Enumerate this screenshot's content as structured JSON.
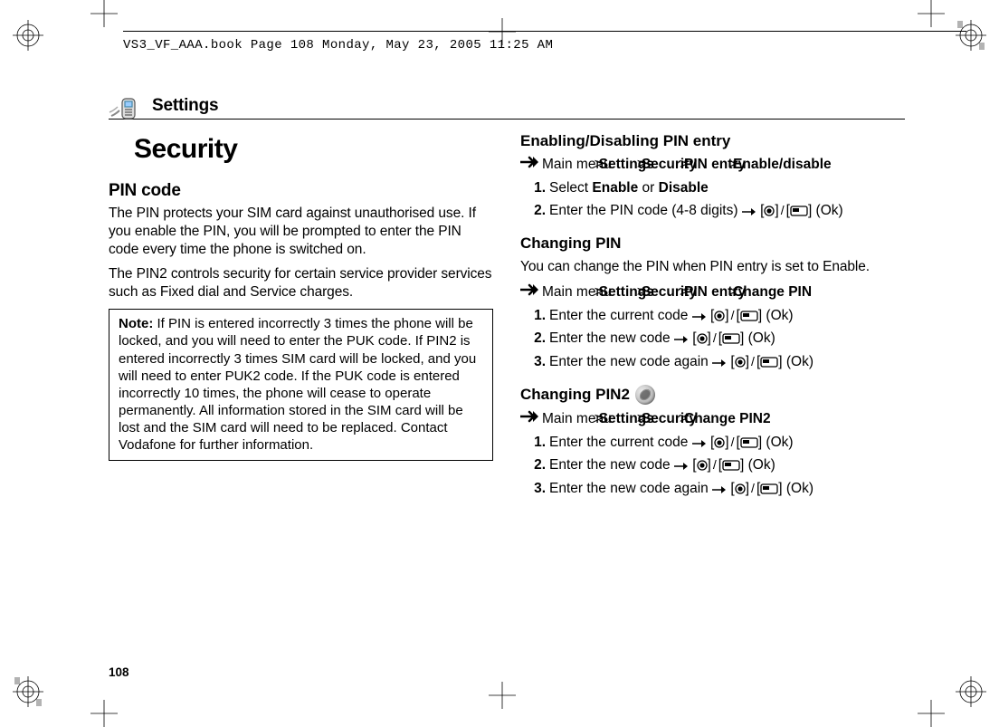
{
  "print_header": "VS3_VF_AAA.book  Page 108  Monday, May 23, 2005  11:25 AM",
  "section_heading": "Settings",
  "page_title": "Security",
  "page_number": "108",
  "left": {
    "h_pin_code": "PIN code",
    "p1": "The PIN protects your SIM card against unauthorised use. If you enable the PIN, you will be prompted to enter the PIN code every time the phone is switched on.",
    "p2": "The PIN2 controls security for certain service provider services such as Fixed dial and Service charges.",
    "note_label": "Note:",
    "note_body": "If PIN is entered incorrectly 3 times the phone will be locked, and you will need to enter the PUK code. If PIN2 is entered incorrectly 3 times SIM card will be locked, and you will need to enter PUK2 code. If the PUK code is entered incorrectly 10 times, the phone will cease to operate permanently. All information stored in the SIM card will be lost and the SIM card will need to be replaced. Contact Vodafone for further information."
  },
  "right": {
    "h_enable": "Enabling/Disabling PIN entry",
    "nav1_pre": "Main menu",
    "nav_settings": "Settings",
    "nav_security": "Security",
    "nav_pin_entry": "PIN entry",
    "nav_enable_disable": "Enable/disable",
    "step_a1_pre": "Select ",
    "step_a1_b1": "Enable",
    "step_a1_mid": " or ",
    "step_a1_b2": "Disable",
    "step_a2_pre": "Enter the PIN code (4-8 digits) ",
    "ok": " (Ok)",
    "h_change_pin": "Changing PIN",
    "p_change_pin": "You can change the PIN when PIN entry is set to Enable.",
    "nav2_tail": "Change PIN",
    "step_b1": "Enter the current code ",
    "step_b2": "Enter the new code ",
    "step_b3": "Enter the new code again ",
    "h_change_pin2": "Changing PIN2",
    "nav3_tail": "Change PIN2",
    "step_c1": "Enter the current code ",
    "step_c2": "Enter the new code ",
    "step_c3": "Enter the new code again "
  },
  "sep": ">"
}
